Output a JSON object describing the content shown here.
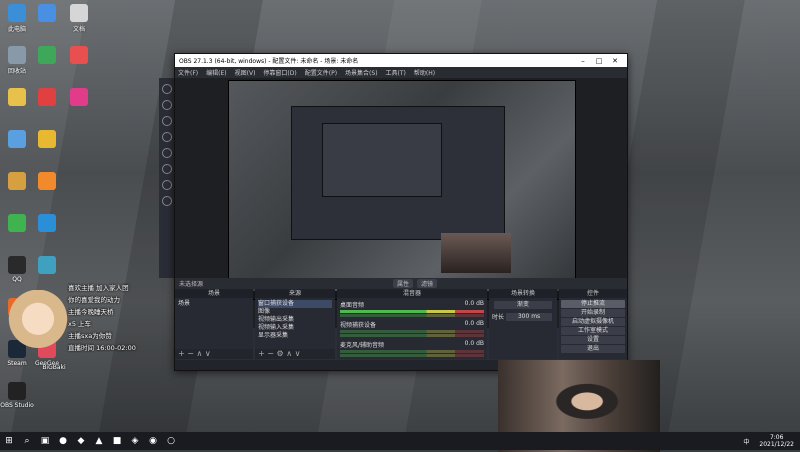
{
  "desktop": {
    "icons": [
      {
        "label": "此电脑",
        "color": "#3b8fd6"
      },
      {
        "label": "回收站",
        "color": "#8899aa"
      },
      {
        "label": "",
        "color": "#e8c04c"
      },
      {
        "label": "",
        "color": "#5aa0e0"
      },
      {
        "label": "",
        "color": "#d6a040"
      },
      {
        "label": "",
        "color": "#3fb34f"
      },
      {
        "label": "QQ",
        "color": "#2a2a2a"
      },
      {
        "label": "",
        "color": "#e86a2a"
      },
      {
        "label": "Steam",
        "color": "#1b2838"
      },
      {
        "label": "OBS Studio",
        "color": "#222"
      }
    ],
    "icons2": [
      {
        "label": "",
        "color": "#4a90e2"
      },
      {
        "label": "",
        "color": "#3fa75a"
      },
      {
        "label": "",
        "color": "#e04040"
      },
      {
        "label": "",
        "color": "#e8b830"
      },
      {
        "label": "",
        "color": "#f08a2a"
      },
      {
        "label": "",
        "color": "#2a8fd6"
      },
      {
        "label": "",
        "color": "#40a0c0"
      },
      {
        "label": "",
        "color": "#d84a3a"
      },
      {
        "label": "GeeGee",
        "color": "#e04a5a"
      }
    ],
    "icons3": [
      {
        "label": "文档",
        "color": "#d6d6d6"
      },
      {
        "label": "",
        "color": "#e85050"
      },
      {
        "label": "",
        "color": "#e03c8a"
      }
    ]
  },
  "obs": {
    "title": "OBS 27.1.3 (64-bit, windows) - 配置文件: 未命名 - 场景: 未命名",
    "menu": [
      "文件(F)",
      "编辑(E)",
      "视图(V)",
      "停靠窗口(D)",
      "配置文件(P)",
      "场景集合(S)",
      "工具(T)",
      "帮助(H)"
    ],
    "dockbar_left": "未选择源",
    "dockbar_btn1": "属性",
    "dockbar_btn2": "滤镜",
    "docks": {
      "scenes": {
        "title": "场景",
        "items": [
          "场景"
        ]
      },
      "sources": {
        "title": "来源",
        "items": [
          "窗口捕获设备",
          "图像",
          "视频输出采集",
          "视频输入采集",
          "显示器采集"
        ]
      },
      "mixer": {
        "title": "混音器",
        "rows": [
          {
            "name": "桌面音频",
            "db": "0.0 dB"
          },
          {
            "name": "视频捕获设备",
            "db": "0.0 dB"
          },
          {
            "name": "麦克风/辅助音频",
            "db": "0.0 dB"
          }
        ]
      },
      "transitions": {
        "title": "场景转换",
        "value": "渐变",
        "duration_label": "时长",
        "duration": "300 ms"
      },
      "controls": {
        "title": "控件",
        "buttons": [
          "停止推流",
          "开始录制",
          "启动虚拟摄像机",
          "工作室模式",
          "设置",
          "退出"
        ]
      }
    },
    "status": "LIVE: 00:00:00"
  },
  "overlay": {
    "lines": [
      "喜欢主播 加入家人团",
      "你的喜爱我的动力",
      "主播今晚睡天桥",
      "x5 上车",
      "主播sxa为你赞",
      "直播时间 16:00-02:00"
    ],
    "avatar_label": "BiGBaki"
  },
  "taskbar": {
    "time": "7:06",
    "date": "2021/12/22",
    "lang": "中",
    "apps": [
      "⊞",
      "⌕",
      "▣",
      "●",
      "◆",
      "▲",
      "■",
      "◈",
      "◉",
      "○"
    ]
  }
}
